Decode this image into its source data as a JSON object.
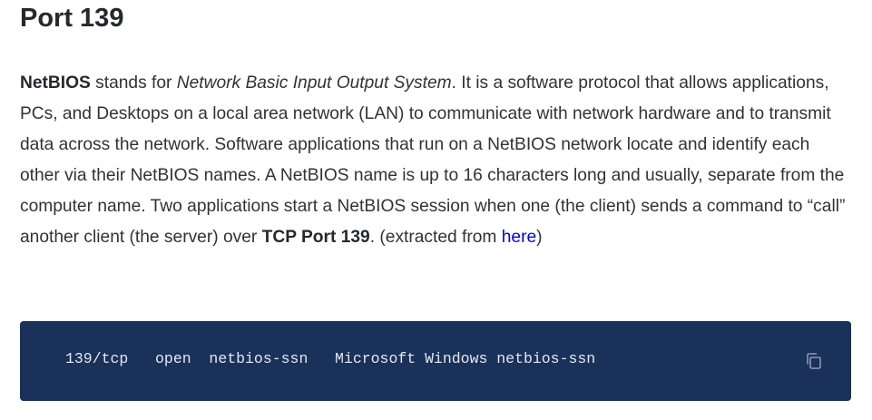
{
  "heading": "Port 139",
  "paragraph": {
    "term": "NetBIOS",
    "t1": " stands for ",
    "expansion": "Network Basic Input Output System",
    "t2": ". It is a software protocol that allows applications, PCs, and Desktops on a local area network (LAN) to communicate with network hardware and to transmit data across the network. Software applications that run on a NetBIOS network locate and identify each other via their NetBIOS names. A NetBIOS name is up to 16 characters long and usually, separate from the computer name. Two applications start a NetBIOS session when one (the client) sends a command to “call” another client (the server) over ",
    "port_ref": "TCP Port 139",
    "t3": ". (extracted from ",
    "link_text": "here",
    "t4": ")"
  },
  "code_block": {
    "text": "139/tcp   open  netbios-ssn   Microsoft Windows netbios-ssn",
    "copy_icon": "copy-icon",
    "background": "#1a3159"
  }
}
